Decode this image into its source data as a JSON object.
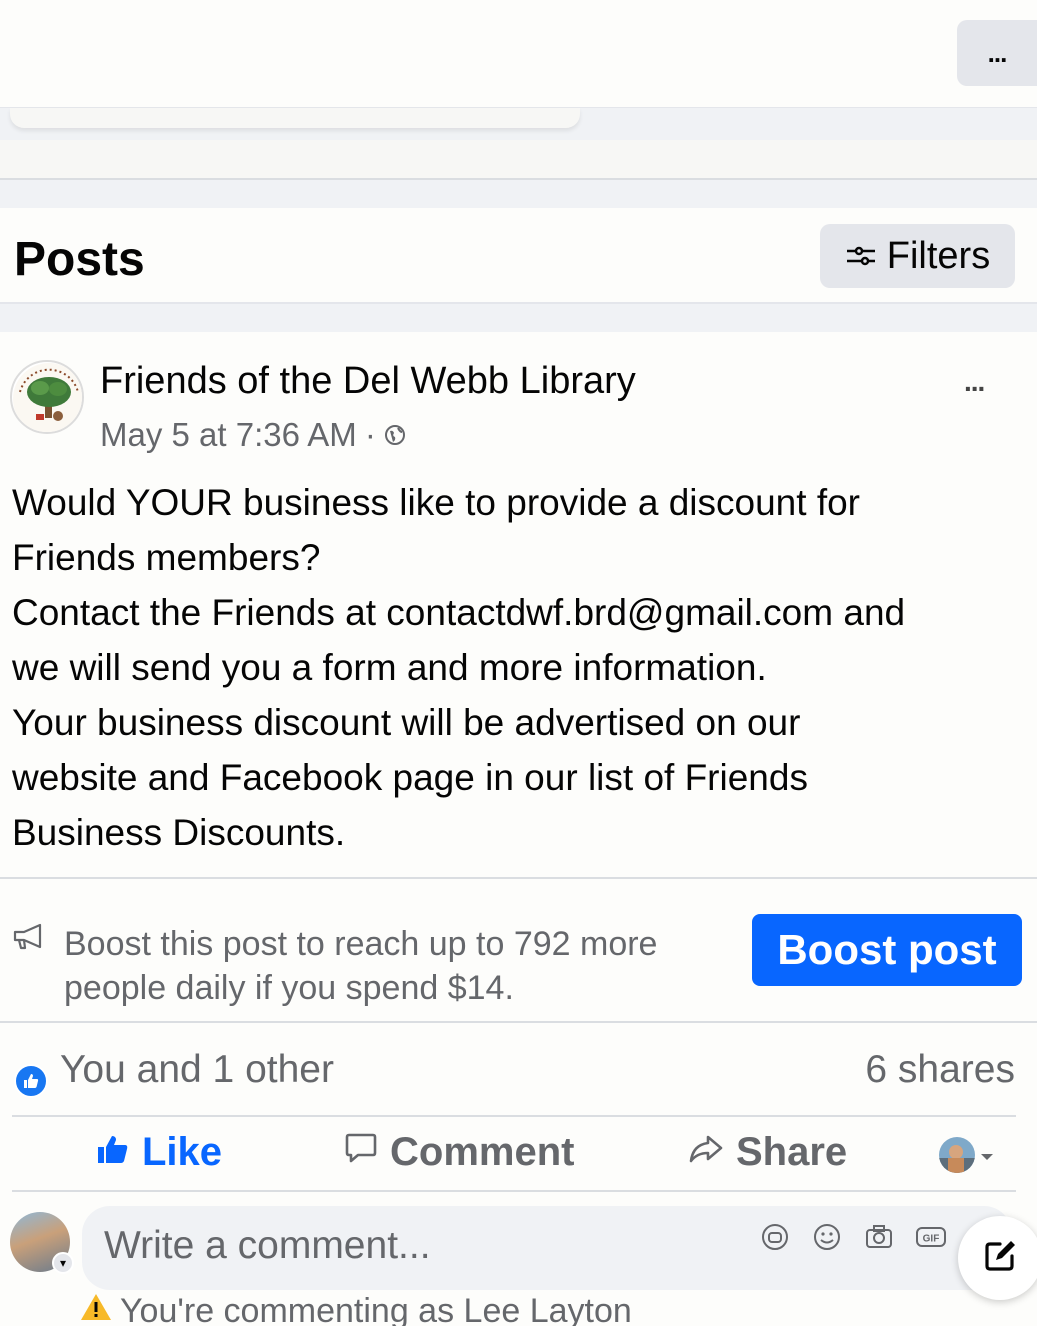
{
  "top": {
    "more_label": "..."
  },
  "posts_header": {
    "title": "Posts",
    "filters_label": "Filters"
  },
  "post": {
    "page_name": "Friends of the Del Webb Library",
    "timestamp": "May 5 at 7:36 AM",
    "separator": "·",
    "privacy_icon": "globe-icon",
    "more_label": "...",
    "body_lines": [
      "Would YOUR business like to provide a discount for",
      "Friends members?",
      "Contact the Friends at contactdwf.brd@gmail.com and",
      "we will send you a form and more information.",
      "Your business discount will be advertised on our",
      "website and Facebook page in our list of Friends",
      "Business Discounts."
    ]
  },
  "boost": {
    "line1": "Boost this post to reach up to 792 more",
    "line2": "people daily if you spend $14.",
    "button_label": "Boost post",
    "icon": "megaphone-icon"
  },
  "reactions": {
    "summary": "You and 1 other",
    "shares": "6 shares",
    "icon": "like-icon"
  },
  "actions": {
    "like": "Like",
    "comment": "Comment",
    "share": "Share"
  },
  "comment": {
    "placeholder": "Write a comment...",
    "commenting_as": "You're commenting as Lee Layton",
    "icons": [
      "avatar-sticker-icon",
      "emoji-icon",
      "camera-icon",
      "gif-icon"
    ]
  },
  "colors": {
    "accent": "#0866ff",
    "secondary_text": "#65676b",
    "background": "#f0f2f5"
  }
}
